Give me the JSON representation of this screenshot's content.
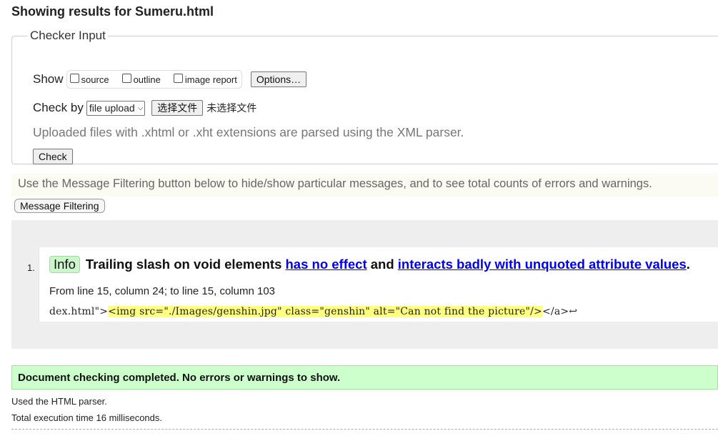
{
  "page": {
    "title": "Showing results for Sumeru.html"
  },
  "checker": {
    "legend": "Checker Input",
    "show_label": "Show",
    "checkboxes": [
      {
        "label": "source",
        "checked": false
      },
      {
        "label": "outline",
        "checked": false
      },
      {
        "label": "image report",
        "checked": false
      }
    ],
    "options_button": "Options…",
    "check_by_label": "Check by",
    "check_by_value": "file upload",
    "file_button": "选择文件",
    "no_file_text": "未选择文件",
    "parser_note": "Uploaded files with .xhtml or .xht extensions are parsed using the XML parser.",
    "check_button": "Check"
  },
  "filter": {
    "note": "Use the Message Filtering button below to hide/show particular messages, and to see total counts of errors and warnings.",
    "button": "Message Filtering"
  },
  "messages": [
    {
      "number": "1.",
      "type": "Info",
      "text_before": "Trailing slash on void elements ",
      "link1": "has no effect",
      "text_middle": " and ",
      "link2": "interacts badly with unquoted attribute values",
      "text_after": ".",
      "location": "From line 15, column 24; to line 15, column 103",
      "code_before": "dex.html\">",
      "code_highlight": "<img src=\"./Images/genshin.jpg\" class=\"genshin\" alt=\"Can not find the picture\"/>",
      "code_after": "</a>↩"
    }
  ],
  "summary": {
    "success": "Document checking completed. No errors or warnings to show.",
    "parser": "Used the HTML parser.",
    "time": "Total execution time 16 milliseconds."
  },
  "colors": {
    "info_badge": "#ccf5cc",
    "success_bg": "#ccffcc",
    "highlight": "#ffff80",
    "link": "#0000ee"
  }
}
